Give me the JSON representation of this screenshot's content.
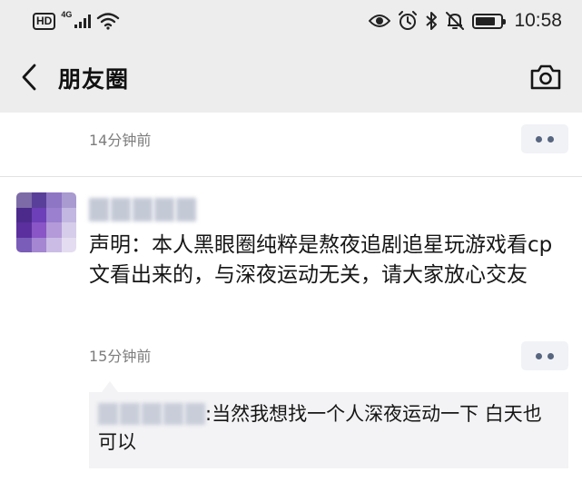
{
  "status_bar": {
    "hd_label": "HD",
    "network_label": "4G",
    "time": "10:58",
    "battery_level": 0.8,
    "icons": [
      "hd-icon",
      "signal-icon",
      "wifi-icon",
      "eye-icon",
      "alarm-icon",
      "bluetooth-icon",
      "mute-icon",
      "battery-icon"
    ]
  },
  "nav": {
    "title": "朋友圈",
    "back_icon": "chevron-left-icon",
    "camera_icon": "camera-icon"
  },
  "feed": {
    "prev_post": {
      "time": "14分钟前"
    },
    "post": {
      "text": "声明：本人黑眼圈纯粹是熬夜追剧追星玩游戏看cp文看出来的，与深夜运动无关，请大家放心交友",
      "time": "15分钟前",
      "comment_text": ":当然我想找一个人深夜运动一下 白天也可以"
    }
  },
  "colors": {
    "bar_bg": "#ededed",
    "more_dot": "#57657f",
    "comment_bg": "#f3f3f5",
    "timestamp": "#7d7d7d"
  }
}
